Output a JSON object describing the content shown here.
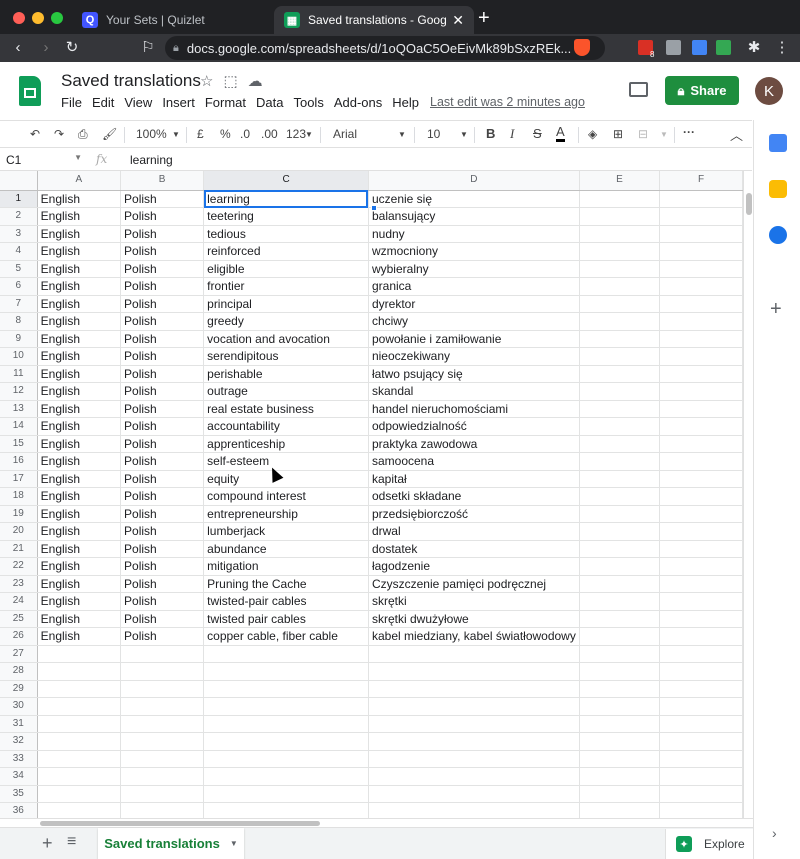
{
  "browser": {
    "tabs": [
      {
        "title": "Your Sets | Quizlet",
        "favicon": "quizlet-icon"
      },
      {
        "title": "Saved translations - Google Sheets",
        "favicon": "google-sheets-icon"
      }
    ],
    "url": "docs.google.com/spreadsheets/d/1oQOaC5OeEivMk89bSxzREk...",
    "extension_badge": "8"
  },
  "header": {
    "title": "Saved translations",
    "menu": [
      "File",
      "Edit",
      "View",
      "Insert",
      "Format",
      "Data",
      "Tools",
      "Add-ons",
      "Help"
    ],
    "last_edit": "Last edit was 2 minutes ago",
    "share_label": "Share",
    "avatar_letter": "K"
  },
  "toolbar": {
    "zoom": "100%",
    "currency": "£",
    "percent": "%",
    "decrease_decimals": ".0",
    "increase_decimals": ".00",
    "more_formats": "123",
    "font": "Arial",
    "font_size": "10",
    "bold": "B",
    "italic": "I",
    "strike": "S",
    "text_color": "A",
    "more": "···"
  },
  "formula_bar": {
    "cell_ref": "C1",
    "fx": "fx",
    "content": "learning"
  },
  "grid": {
    "columns": [
      "A",
      "B",
      "C",
      "D",
      "E",
      "F"
    ],
    "selected_column": "C",
    "selected_row": 1,
    "rows": [
      [
        "English",
        "Polish",
        "learning",
        "uczenie się"
      ],
      [
        "English",
        "Polish",
        "teetering",
        "balansujący"
      ],
      [
        "English",
        "Polish",
        "tedious",
        "nudny"
      ],
      [
        "English",
        "Polish",
        "reinforced",
        "wzmocniony"
      ],
      [
        "English",
        "Polish",
        "eligible",
        "wybieralny"
      ],
      [
        "English",
        "Polish",
        "frontier",
        "granica"
      ],
      [
        "English",
        "Polish",
        "principal",
        "dyrektor"
      ],
      [
        "English",
        "Polish",
        "greedy",
        "chciwy"
      ],
      [
        "English",
        "Polish",
        "vocation and avocation",
        "powołanie i zamiłowanie"
      ],
      [
        "English",
        "Polish",
        "serendipitous",
        "nieoczekiwany"
      ],
      [
        "English",
        "Polish",
        "perishable",
        "łatwo psujący się"
      ],
      [
        "English",
        "Polish",
        "outrage",
        "skandal"
      ],
      [
        "English",
        "Polish",
        "real estate business",
        "handel nieruchomościami"
      ],
      [
        "English",
        "Polish",
        "accountability",
        "odpowiedzialność"
      ],
      [
        "English",
        "Polish",
        "apprenticeship",
        "praktyka zawodowa"
      ],
      [
        "English",
        "Polish",
        "self-esteem",
        "samoocena"
      ],
      [
        "English",
        "Polish",
        "equity",
        "kapitał"
      ],
      [
        "English",
        "Polish",
        "compound interest",
        "odsetki składane"
      ],
      [
        "English",
        "Polish",
        "entrepreneurship",
        "przedsiębiorczość"
      ],
      [
        "English",
        "Polish",
        "lumberjack",
        "drwal"
      ],
      [
        "English",
        "Polish",
        "abundance",
        "dostatek"
      ],
      [
        "English",
        "Polish",
        "mitigation",
        "łagodzenie"
      ],
      [
        "English",
        "Polish",
        "Pruning the Cache",
        "Czyszczenie pamięci podręcznej"
      ],
      [
        "English",
        "Polish",
        "twisted-pair cables",
        "skrętki"
      ],
      [
        "English",
        "Polish",
        "twisted pair cables",
        "skrętki dwużyłowe"
      ],
      [
        "English",
        "Polish",
        "copper cable, fiber cable",
        "kabel miedziany, kabel światłowodowy"
      ]
    ],
    "total_rows": 36
  },
  "sheetbar": {
    "active_sheet": "Saved translations",
    "explore_label": "Explore"
  },
  "colors": {
    "brand_green": "#0f9d58",
    "share_green": "#1e8e3e",
    "selection_blue": "#1a73e8"
  }
}
